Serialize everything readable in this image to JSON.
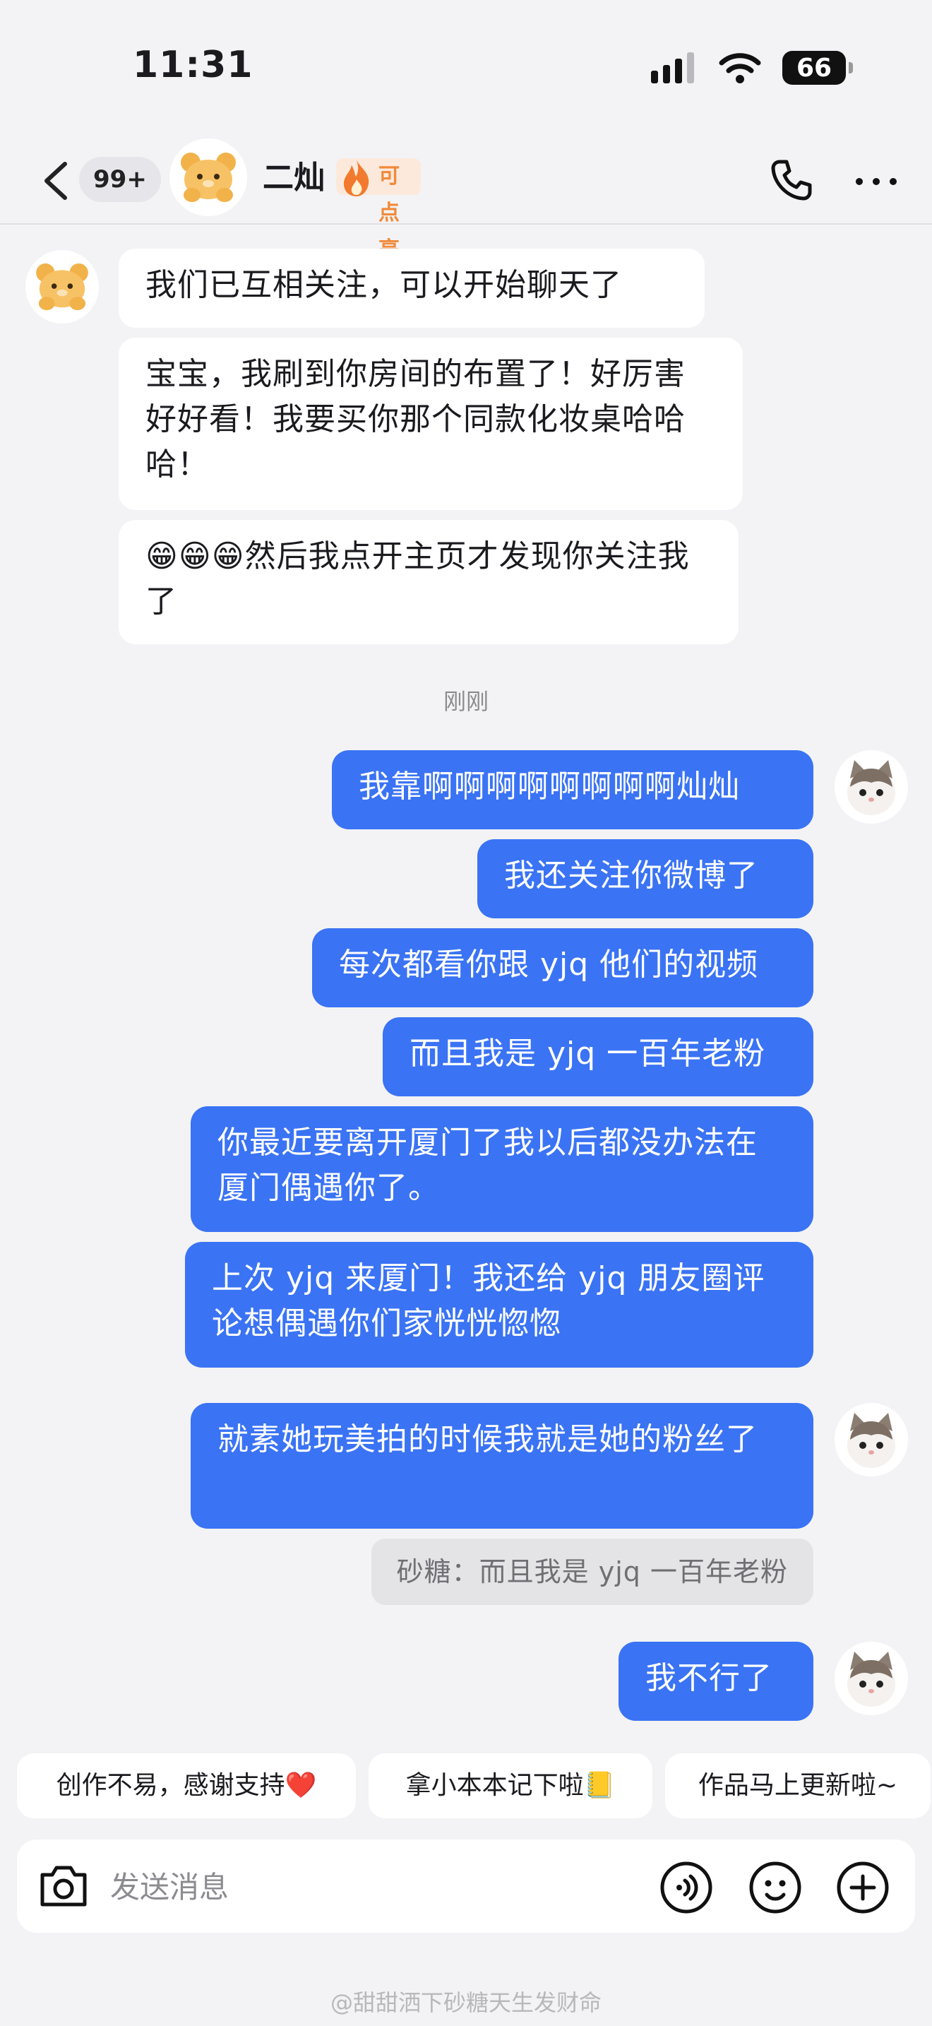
{
  "status_bar": {
    "time": "11:31",
    "battery": "66"
  },
  "header": {
    "back_badge": "99+",
    "contact_name": "二灿",
    "light_up_label": "可点亮"
  },
  "messages_incoming": [
    "我们已互相关注，可以开始聊天了",
    "宝宝，我刷到你房间的布置了！好厉害好好看！我要买你那个同款化妆桌哈哈哈！",
    "😁😁😁然后我点开主页才发现你关注我了"
  ],
  "timestamp": "刚刚",
  "messages_outgoing": [
    "我靠啊啊啊啊啊啊啊啊灿灿",
    "我还关注你微博了",
    "每次都看你跟 yjq 他们的视频",
    "而且我是 yjq 一百年老粉",
    "你最近要离开厦门了我以后都没办法在厦门偶遇你了。",
    "上次 yjq 来厦门！我还给 yjq 朋友圈评论想偶遇你们家恍恍惚惚",
    "就素她玩美拍的时候我就是她的粉丝了",
    "我不行了"
  ],
  "quoted_reply": "砂糖：而且我是 yjq 一百年老粉",
  "quick_replies": [
    "创作不易，感谢支持❤️",
    "拿小本本记下啦📒",
    "作品马上更新啦~"
  ],
  "input": {
    "placeholder": "发送消息"
  },
  "watermark": "@甜甜洒下砂糖天生发财命",
  "colors": {
    "outgoing_bubble": "#3a73f4",
    "background": "#f3f3f5",
    "accent_light": "#f08a3a"
  },
  "icons": {
    "signal": "cellular-signal-icon",
    "wifi": "wifi-icon",
    "back": "chevron-left-icon",
    "call": "phone-icon",
    "more": "more-dots-icon",
    "camera": "camera-icon",
    "voice": "voice-icon",
    "emoji": "emoji-icon",
    "add": "plus-circle-icon"
  }
}
